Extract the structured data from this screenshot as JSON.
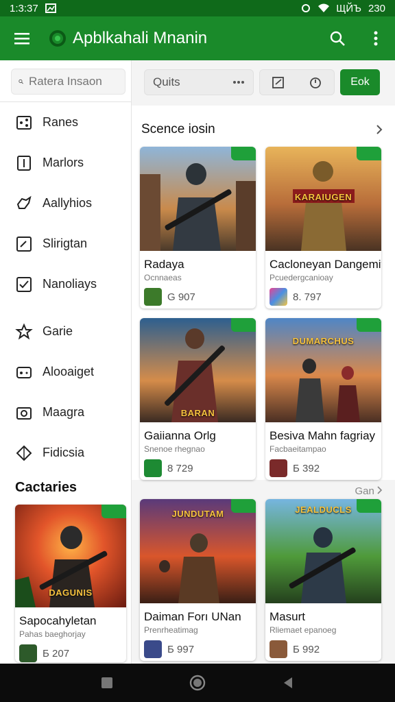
{
  "status": {
    "time": "1:3:37",
    "right": "ЩЙЪ",
    "battery": "230"
  },
  "appbar": {
    "title": "Apblkahali Mnanin"
  },
  "sidebar": {
    "search_placeholder": "Ratera Insaon",
    "items": [
      {
        "label": "Ranes",
        "icon": "share-icon"
      },
      {
        "label": "Marlors",
        "icon": "book-icon"
      },
      {
        "label": "Aallyhios",
        "icon": "puzzle-icon"
      },
      {
        "label": "Slirigtan",
        "icon": "edit-box-icon"
      },
      {
        "label": "Nanoliays",
        "icon": "check-box-icon"
      },
      {
        "label": "Garie",
        "icon": "star-icon"
      },
      {
        "label": "Alooaiget",
        "icon": "gamepad-icon"
      },
      {
        "label": "Maagra",
        "icon": "camera-icon"
      },
      {
        "label": "Fidicsia",
        "icon": "diamond-icon"
      }
    ],
    "section_heading": "Cactaries",
    "featured": {
      "name": "Sapocahyletan",
      "sub": "Pahas baeghorjay",
      "rating": "Б 207",
      "art_title": "DAGUNIS"
    }
  },
  "toolbar": {
    "filter_label": "Quits",
    "button_label": "Eok"
  },
  "section": {
    "title": "Scence iosin",
    "see_all": "Gan"
  },
  "games_top": [
    {
      "name": "Radaya",
      "sub": "Ocnnaeas",
      "rating": "G 907",
      "art_title": ""
    },
    {
      "name": "Cacloneyan Dangemiy",
      "sub": "Pcuedergcanioay",
      "rating": "8. 797",
      "art_title": "KARAIUGEN"
    },
    {
      "name": "Gaiianna Orlg",
      "sub": "Snenoe rhegnao",
      "rating": "8 729",
      "art_title": "BARAN"
    },
    {
      "name": "Besiva Mahn fagriay",
      "sub": "Facbaeitampao",
      "rating": "Б 392",
      "art_title": "DUMARCHUS"
    }
  ],
  "games_bottom": [
    {
      "name": "Daiman Forı UNan",
      "sub": "Prenrheatimag",
      "rating": "Б 997",
      "art_title": "JUNDUTAM"
    },
    {
      "name": "Masurt",
      "sub": "Rliemaet epanoeg",
      "rating": "Б 992",
      "art_title": "JEALDUCLS"
    }
  ]
}
